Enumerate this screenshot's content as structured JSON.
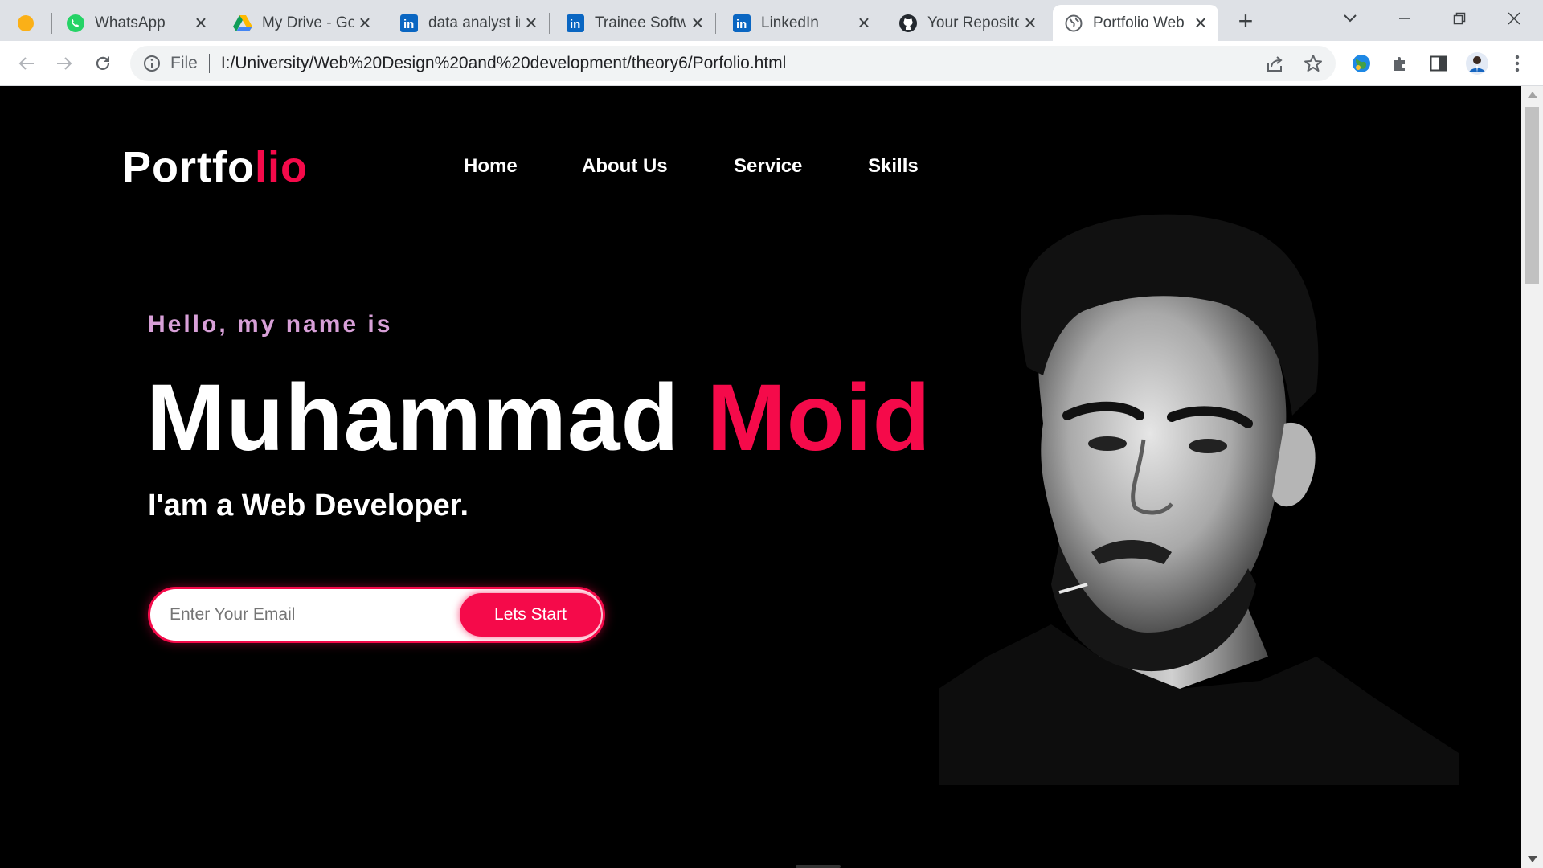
{
  "browser": {
    "tabs": [
      {
        "title": "",
        "icon": "orange-dot-icon"
      },
      {
        "title": "WhatsApp",
        "icon": "whatsapp-icon"
      },
      {
        "title": "My Drive - Go",
        "icon": "google-drive-icon"
      },
      {
        "title": "data analyst ir",
        "icon": "linkedin-icon"
      },
      {
        "title": "Trainee Softw",
        "icon": "linkedin-icon"
      },
      {
        "title": "LinkedIn",
        "icon": "linkedin-icon"
      },
      {
        "title": "Your Reposito",
        "icon": "github-icon"
      },
      {
        "title": "Portfolio Web",
        "icon": "globe-icon",
        "active": true
      }
    ],
    "address": {
      "scheme_label": "File",
      "url": "I:/University/Web%20Design%20and%20development/theory6/Porfolio.html"
    },
    "colors": {
      "tabbar": "#dee1e6",
      "active_tab": "#ffffff",
      "omnibox": "#f1f3f4"
    }
  },
  "site": {
    "logo": {
      "main": "Portfo",
      "accent": "lio"
    },
    "nav": [
      "Home",
      "About Us",
      "Service",
      "Skills"
    ],
    "hero": {
      "greeting": "Hello, my name is",
      "first_name": "Muhammad",
      "last_name": "Moid",
      "role": "I'am a Web Developer.",
      "email_placeholder": "Enter Your Email",
      "cta": "Lets Start"
    },
    "colors": {
      "accent": "#f50a4a",
      "greeting": "#d8a0d8",
      "background": "#000000",
      "text": "#ffffff"
    }
  }
}
